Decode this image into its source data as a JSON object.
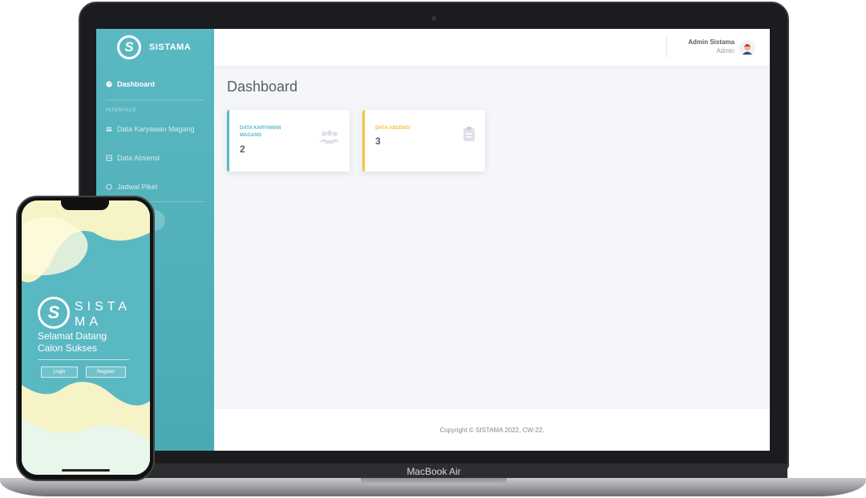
{
  "laptop": {
    "model_label": "MacBook Air",
    "app": {
      "brand_name": "SISTAMA",
      "brand_logo_glyph": "S",
      "accent_color": "#5ab8c3",
      "warning_color": "#f6c23e",
      "sidebar": {
        "active_item": "Dashboard",
        "heading": "INTERFACE",
        "items": [
          {
            "label": "Data Karyawan Magang",
            "icon": "users-icon"
          },
          {
            "label": "Data Absensi",
            "icon": "table-icon"
          },
          {
            "label": "Jadwal Piket",
            "icon": "calendar-icon"
          }
        ]
      },
      "topbar": {
        "user_name": "Admin Sistama",
        "user_role": "Admin"
      },
      "page_title": "Dashboard",
      "cards": [
        {
          "label": "DATA KARYAWAN MAGANG",
          "value": "2",
          "icon": "users-icon"
        },
        {
          "label": "DATA ABSENSI",
          "value": "3",
          "icon": "clipboard-icon"
        }
      ],
      "footer": "Copyright © SISTAMA 2022, CW-22."
    }
  },
  "phone": {
    "logo_glyph": "S",
    "brand": "SISTA MA",
    "welcome": "Selamat Datang Calon Sukses",
    "buttons": {
      "login": "Login",
      "register": "Register"
    }
  }
}
